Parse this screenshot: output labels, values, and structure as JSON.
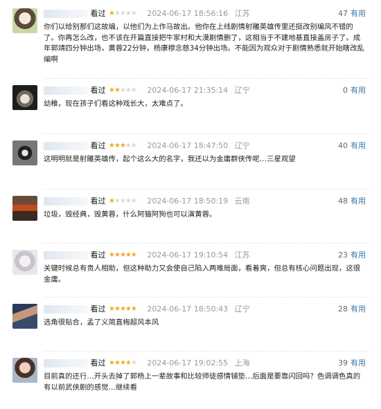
{
  "comments": [
    {
      "status": "看过",
      "rating": 1,
      "time": "2024-06-17 18:56:16",
      "location": "江苏",
      "votes": "47",
      "useful_label": "有用",
      "text": "你们以给别那们这故编，以他们为上作马故出。他你在上线剧情射雕英雄传里还挺改别编风不错的了。你再怎么改，也不该在开篇直接把牛家村和大漠剧情删了，这相当于不建地基直接盖房子了。成年郭靖四分钟出场，黄蓉22分钟，杨康穆念慈34分钟出场。不能因为观众对于剧情熟悉就开始瞎改乱编啊"
    },
    {
      "status": "看过",
      "rating": 2,
      "time": "2024-06-17 21:35:14",
      "location": "辽宁",
      "votes": "0",
      "useful_label": "有用",
      "text": "幼稚，现在孩子们看这种戏长大，太难点了。"
    },
    {
      "status": "看过",
      "rating": 3,
      "time": "2024-06-17 18:47:50",
      "location": "辽宁",
      "votes": "40",
      "useful_label": "有用",
      "text": "这明明就是射雕英雄传，起个这么大的名字，我还以为金庸群侠传呢…三星观望"
    },
    {
      "status": "看过",
      "rating": 1,
      "time": "2024-06-17 18:50:19",
      "location": "云南",
      "votes": "48",
      "useful_label": "有用",
      "text": "垃圾，毁经典，毁黄蓉，什么阿猫阿狗也可以演黄蓉。"
    },
    {
      "status": "看过",
      "rating": 5,
      "time": "2024-06-17 19:10:54",
      "location": "江苏",
      "votes": "23",
      "useful_label": "有用",
      "text": "关键时候总有贵人相助，但这种助力又会使自己陷入两难局面，看着爽，但总有核心问题出现，这很金庸。"
    },
    {
      "status": "看过",
      "rating": 5,
      "time": "2024-06-17 18:50:43",
      "location": "辽宁",
      "votes": "28",
      "useful_label": "有用",
      "text": "选角很贴合，孟了义简直梅超风本风"
    },
    {
      "status": "看过",
      "rating": 4,
      "time": "2024-06-17 19:02:55",
      "location": "上海",
      "votes": "39",
      "useful_label": "有用",
      "text": "目前真的还行…开头去掉了郭杨上一辈故事和比较师徒感情铺垫…后面是要靠闪回吗？色调调色真的有以前武侠剧的感觉…继续看"
    }
  ],
  "colors": {
    "star_on": "#f5a623",
    "star_off": "#d8d8d8",
    "link": "#3377aa"
  }
}
